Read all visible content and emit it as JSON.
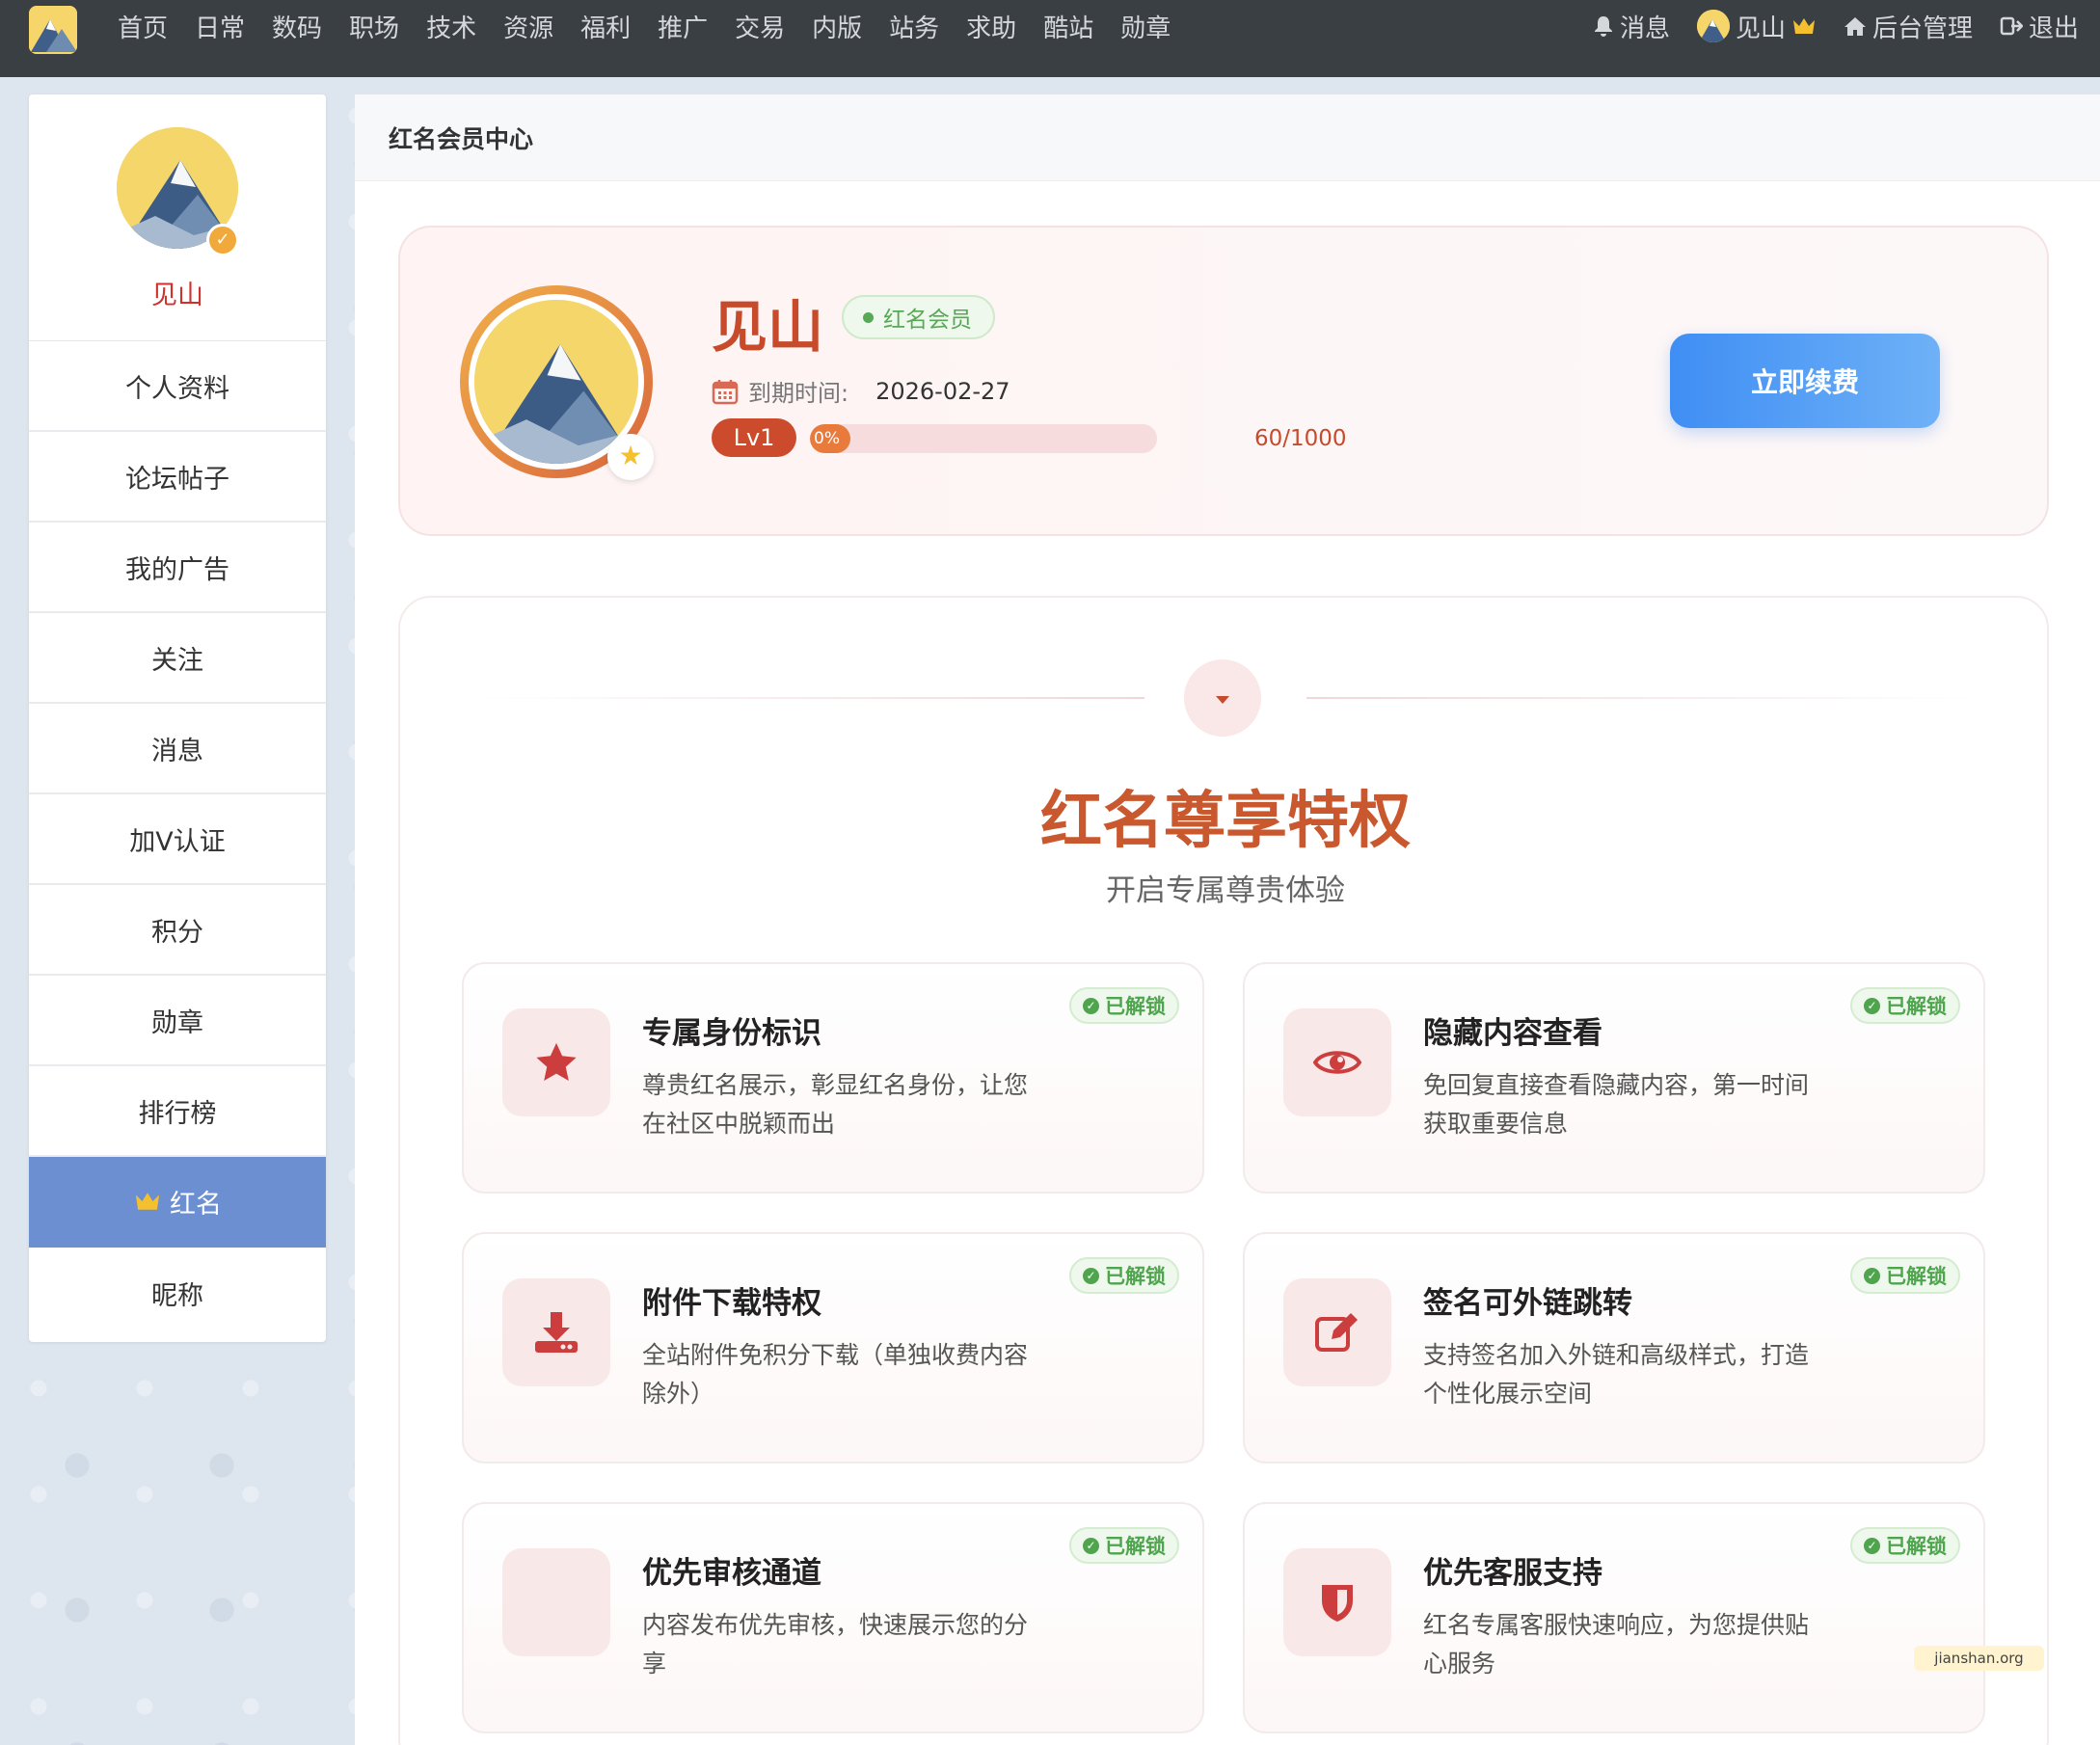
{
  "topnav": {
    "items": [
      "首页",
      "日常",
      "数码",
      "职场",
      "技术",
      "资源",
      "福利",
      "推广",
      "交易",
      "内版",
      "站务",
      "求助",
      "酷站",
      "勋章"
    ],
    "messages": "消息",
    "username": "见山",
    "admin": "后台管理",
    "logout": "退出"
  },
  "sidebar": {
    "name": "见山",
    "items": [
      "个人资料",
      "论坛帖子",
      "我的广告",
      "关注",
      "消息",
      "加V认证",
      "积分",
      "勋章",
      "排行榜",
      "红名",
      "昵称"
    ],
    "active_index": 9
  },
  "main": {
    "header": "红名会员中心",
    "member": {
      "name": "见山",
      "badge": "红名会员",
      "expire_label": "到期时间:",
      "expire_value": "2026-02-27",
      "level": "Lv1",
      "progress_text": "0%",
      "progress_fraction": 0.0,
      "progress_count": "60/1000",
      "renew_button": "立即续费"
    },
    "privileges": {
      "title": "红名尊享特权",
      "subtitle": "开启专属尊贵体验",
      "unlock_label": "已解锁",
      "cards": [
        {
          "icon": "star-icon",
          "title": "专属身份标识",
          "desc": "尊贵红名展示，彰显红名身份，让您在社区中脱颖而出"
        },
        {
          "icon": "eye-icon",
          "title": "隐藏内容查看",
          "desc": "免回复直接查看隐藏内容，第一时间获取重要信息"
        },
        {
          "icon": "download-icon",
          "title": "附件下载特权",
          "desc": "全站附件免积分下载（单独收费内容除外）"
        },
        {
          "icon": "edit-icon",
          "title": "签名可外链跳转",
          "desc": "支持签名加入外链和高级样式，打造个性化展示空间"
        },
        {
          "icon": "fast-lane-icon",
          "title": "优先审核通道",
          "desc": "内容发布优先审核，快速展示您的分享"
        },
        {
          "icon": "shield-icon",
          "title": "优先客服支持",
          "desc": "红名专属客服快速响应，为您提供贴心服务"
        }
      ]
    }
  },
  "watermark": "jianshan.org",
  "colors": {
    "topnav_bg": "#3a3f44",
    "accent_red": "#c74a2a",
    "active_sidebar": "#6b8fd0",
    "renew_blue": "#3f8ef4",
    "unlock_green": "#4ea54d"
  }
}
